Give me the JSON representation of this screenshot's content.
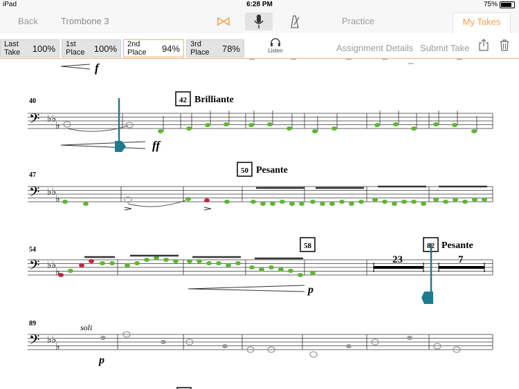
{
  "status": {
    "device": "iPad",
    "time": "6:28 PM",
    "battery": "75%"
  },
  "nav": {
    "back": "Back",
    "title": "Trombone 3",
    "practice": "Practice",
    "my_takes": "My Takes",
    "icons": [
      "duet-icon",
      "microphone-icon",
      "metronome-icon"
    ]
  },
  "takes": [
    {
      "label": "Last Take",
      "score": "100%"
    },
    {
      "label": "1st Place",
      "score": "100%"
    },
    {
      "label": "2nd Place",
      "score": "94%"
    },
    {
      "label": "3rd Place",
      "score": "78%"
    }
  ],
  "toolbar": {
    "listen": "Listen",
    "assignment_details": "Assignment Details",
    "submit_take": "Submit Take"
  },
  "score": {
    "top_dynamic": "f",
    "systems": [
      {
        "measure": "40",
        "rehearsal": "42",
        "tempo": "Brilliante",
        "dynamic": "ff"
      },
      {
        "measure": "47",
        "rehearsal": "50",
        "tempo": "Pesante"
      },
      {
        "measure": "54",
        "rehearsal": "58",
        "rehearsal2": "82",
        "tempo2": "Pesante",
        "dynamic": "p",
        "rest1": "23",
        "rest2": "7"
      },
      {
        "measure": "89",
        "expression": "soli",
        "dynamic": "p"
      }
    ]
  },
  "colors": {
    "accent": "#f0a24a",
    "correct": "#5bb82e",
    "wrong": "#c0283c",
    "cursor": "#1e7a8c"
  }
}
